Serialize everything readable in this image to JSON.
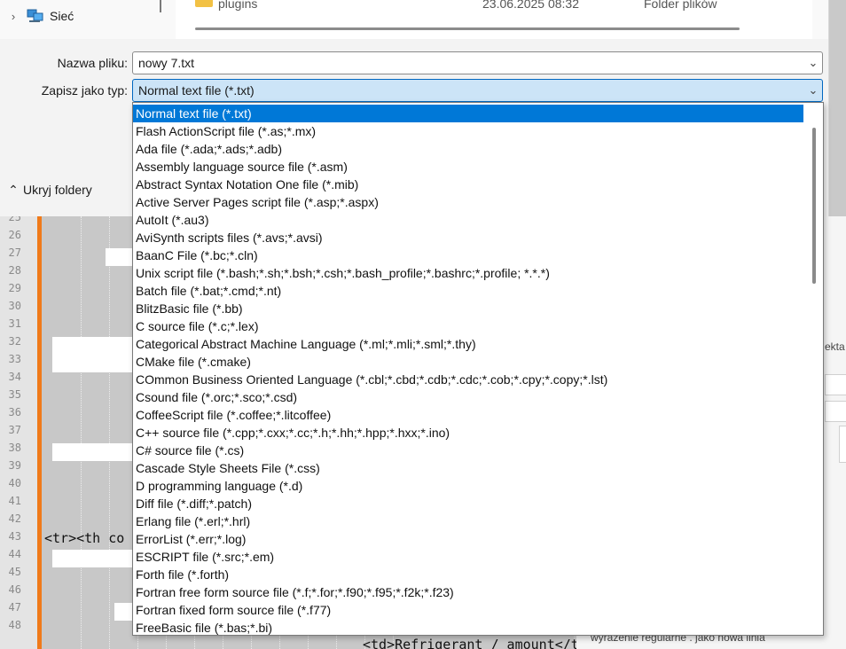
{
  "dialog": {
    "tree_item": {
      "label": "Sieć",
      "icon": "network-icon"
    },
    "file_row": {
      "name": "plugins",
      "date": "23.06.2025 08:32",
      "type": "Folder plików"
    },
    "filename_label": "Nazwa pliku:",
    "filename_value": "nowy 7.txt",
    "savetype_label": "Zapisz jako typ:",
    "savetype_value": "Normal text file (*.txt)",
    "hide_folders_label": "Ukryj foldery"
  },
  "dropdown": {
    "selected_index": 0,
    "options": [
      "Normal text file (*.txt)",
      "Flash ActionScript file (*.as;*.mx)",
      "Ada file (*.ada;*.ads;*.adb)",
      "Assembly language source file (*.asm)",
      "Abstract Syntax Notation One file (*.mib)",
      "Active Server Pages script file (*.asp;*.aspx)",
      "AutoIt (*.au3)",
      "AviSynth scripts files (*.avs;*.avsi)",
      "BaanC File (*.bc;*.cln)",
      "Unix script file (*.bash;*.sh;*.bsh;*.csh;*.bash_profile;*.bashrc;*.profile; *.*.*)",
      "Batch file (*.bat;*.cmd;*.nt)",
      "BlitzBasic file (*.bb)",
      "C source file (*.c;*.lex)",
      "Categorical Abstract Machine Language (*.ml;*.mli;*.sml;*.thy)",
      "CMake file (*.cmake)",
      "COmmon Business Oriented Language (*.cbl;*.cbd;*.cdb;*.cdc;*.cob;*.cpy;*.copy;*.lst)",
      "Csound file (*.orc;*.sco;*.csd)",
      "CoffeeScript file (*.coffee;*.litcoffee)",
      "C++ source file (*.cpp;*.cxx;*.cc;*.h;*.hh;*.hpp;*.hxx;*.ino)",
      "C# source file (*.cs)",
      "Cascade Style Sheets File (*.css)",
      "D programming language (*.d)",
      "Diff file (*.diff;*.patch)",
      "Erlang file (*.erl;*.hrl)",
      "ErrorList (*.err;*.log)",
      "ESCRIPT file (*.src;*.em)",
      "Forth file (*.forth)",
      "Fortran free form source file (*.f;*.for;*.f90;*.f95;*.f2k;*.f23)",
      "Fortran fixed form source file (*.f77)",
      "FreeBasic file (*.bas;*.bi)"
    ]
  },
  "editor": {
    "line_numbers": [
      "25",
      "26",
      "27",
      "28",
      "29",
      "30",
      "31",
      "32",
      "33",
      "34",
      "35",
      "36",
      "37",
      "38",
      "39",
      "40",
      "41",
      "42",
      "43",
      "44",
      "45",
      "46",
      "47",
      "48"
    ],
    "line_43": "<tr><th co",
    "bottom_code": "<td>Refrigerant / amount</td>",
    "right_partial": "ekta",
    "bottom_right_text": "wyrażenie regularne       . jako nowa linia"
  },
  "colors": {
    "selection": "#0078d7",
    "combo_focus": "#cce4f7",
    "fold_margin": "#f07a1a"
  }
}
